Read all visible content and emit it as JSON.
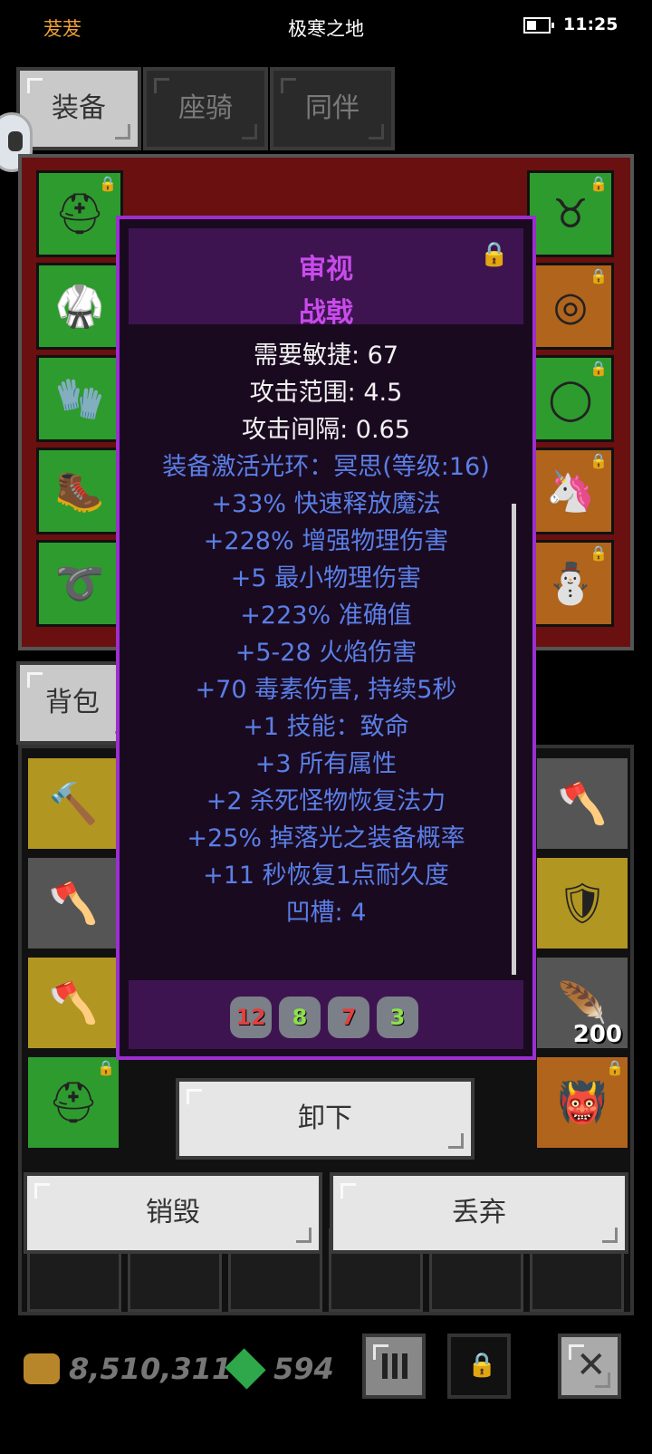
{
  "status_bar": {
    "player_name": "茇茇",
    "zone_name": "极寒之地",
    "time": "11:25"
  },
  "tabs": [
    {
      "label": "装备",
      "active": true
    },
    {
      "label": "座骑",
      "active": false
    },
    {
      "label": "同伴",
      "active": false
    }
  ],
  "bag_tab": {
    "label": "背包"
  },
  "item": {
    "prefix": "审视",
    "name": "战戟",
    "requirements": [
      "需要敏捷: 67",
      "攻击范围: 4.5",
      "攻击间隔: 0.65"
    ],
    "affixes": [
      "装备激活光环：冥思(等级:16)",
      "+33% 快速释放魔法",
      "+228% 增强物理伤害",
      "+5 最小物理伤害",
      "+223% 准确值",
      "+5-28 火焰伤害",
      "+70 毒素伤害, 持续5秒",
      "+1 技能：致命",
      "+3 所有属性",
      "+2 杀死怪物恢复法力",
      "+25% 掉落光之装备概率",
      "+11 秒恢复1点耐久度",
      "凹槽: 4"
    ],
    "sockets": [
      {
        "label": "12",
        "color": "#e04040"
      },
      {
        "label": "8",
        "color": "#8ee04a"
      },
      {
        "label": "7",
        "color": "#e04040"
      },
      {
        "label": "3",
        "color": "#8ee04a"
      }
    ]
  },
  "actions": {
    "unequip": "卸下",
    "destroy": "销毁",
    "discard": "丢弃"
  },
  "bag_items": {
    "feather_qty": "200"
  },
  "currency": {
    "gold": "8,510,311",
    "gems": "594"
  },
  "icons": {
    "lock": "lock-icon",
    "grid": "grid-icon",
    "close": "close-icon",
    "gold": "gold-coins-icon",
    "gem": "green-gem-icon",
    "battery": "battery-icon"
  },
  "colors": {
    "player_name": "#f0a23a",
    "item_title": "#c84bea",
    "affix_text": "#5a7fe6",
    "popup_border": "#9b2fd0",
    "popup_bg": "#1a0a20"
  }
}
